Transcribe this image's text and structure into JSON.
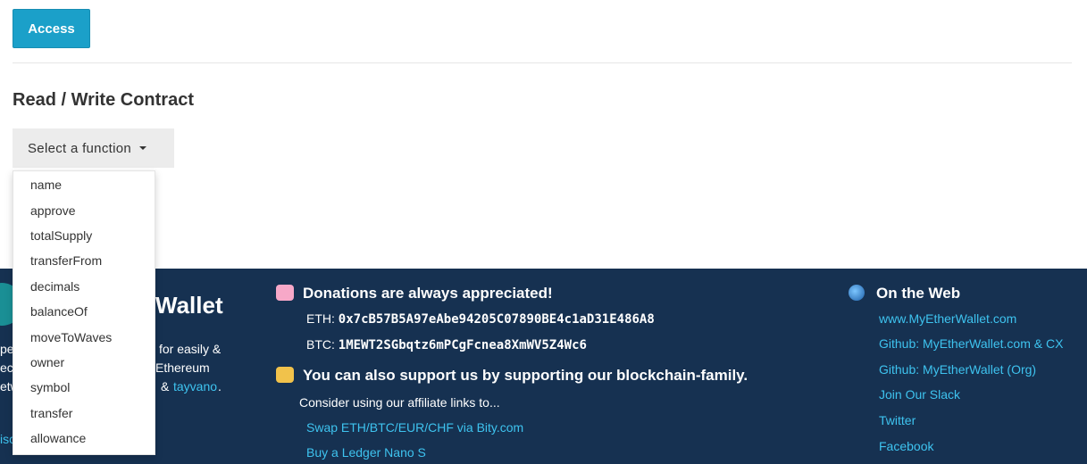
{
  "top": {
    "access_label": "Access",
    "section_title": "Read / Write Contract",
    "select_label": "Select a function"
  },
  "dropdown": {
    "items": [
      "name",
      "approve",
      "totalSupply",
      "transferFrom",
      "decimals",
      "balanceOf",
      "moveToWaves",
      "owner",
      "symbol",
      "transfer",
      "allowance"
    ]
  },
  "footer": {
    "logo_text": "Wallet",
    "about_fragments": [
      "pe",
      "for easily &",
      "ecu",
      "Ethereum",
      "etw",
      "&",
      "tayvano",
      ".",
      "isc"
    ],
    "donations": {
      "title": "Donations are always appreciated!",
      "eth_label": "ETH:",
      "eth_address": "0x7cB57B5A97eAbe94205C07890BE4c1aD31E486A8",
      "btc_label": "BTC:",
      "btc_address": "1MEWT2SGbqtz6mPCgFcnea8XmWV5Z4Wc6"
    },
    "support": {
      "title": "You can also support us by supporting our blockchain-family.",
      "consider": "Consider using our affiliate links to...",
      "links": [
        "Swap ETH/BTC/EUR/CHF via Bity.com",
        "Buy a Ledger Nano S"
      ]
    },
    "web": {
      "title": "On the Web",
      "links": [
        "www.MyEtherWallet.com",
        "Github: MyEtherWallet.com & CX",
        "Github: MyEtherWallet (Org)",
        "Join Our Slack",
        "Twitter",
        "Facebook"
      ]
    },
    "colors": {
      "footer_bg": "#163151",
      "link": "#3ec3ef",
      "accent": "#1ba0c9"
    }
  }
}
